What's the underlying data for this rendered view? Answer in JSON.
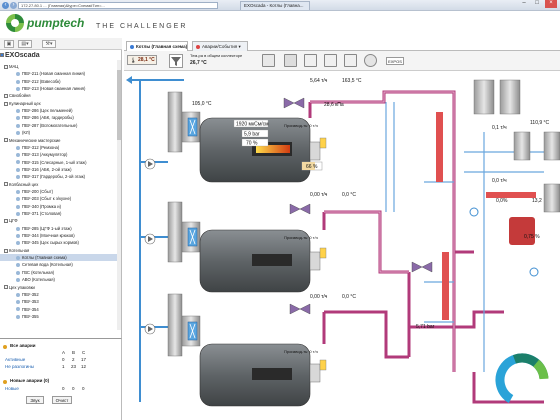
{
  "browser": {
    "url": "172.27.80.1 ... (Главная)&type=Схема#Тип=...",
    "tabs": [
      {
        "label": "EXOscada - Котлы (Главна..."
      }
    ],
    "win_min": "–",
    "win_max": "□",
    "win_close": "×"
  },
  "header": {
    "logo": "pumptech",
    "tagline": "THE CHALLENGER"
  },
  "sidebar": {
    "root": "EXOscada",
    "items": [
      {
        "label": "МАЦ",
        "level": 1
      },
      {
        "label": "ПВУ-211 (Новая сманная линия)",
        "level": 2
      },
      {
        "label": "ПВУ-212 (Взвесобк)",
        "level": 2
      },
      {
        "label": "ПВУ-213 (Новая сманная линия)",
        "level": 2
      },
      {
        "label": "Свиобойня",
        "level": 1
      },
      {
        "label": "Кулинарный цех",
        "level": 1
      },
      {
        "label": "ПВУ-286 (Цех пельменей)",
        "level": 2
      },
      {
        "label": "ПВУ-286 (АБК, гардеробы)",
        "level": 2
      },
      {
        "label": "ПВУ-287 (Вспомогательные)",
        "level": 2
      },
      {
        "label": "(КЛ)",
        "level": 2
      },
      {
        "label": "Механические мастерские",
        "level": 1
      },
      {
        "label": "ПВУ-312 (Ремзона)",
        "level": 2
      },
      {
        "label": "ПВУ-313 (Аккумулятор)",
        "level": 2
      },
      {
        "label": "ПВУ-315 (Слесарные, 1-ый этаж)",
        "level": 2
      },
      {
        "label": "ПВУ-316 (АБК, 2-ой этаж)",
        "level": 2
      },
      {
        "label": "ПВУ-317 (Гардеробы, 2-ой этаж)",
        "level": 2
      },
      {
        "label": "Колбасный цех",
        "level": 1
      },
      {
        "label": "ПВУ-200 (Сбыт)",
        "level": 2
      },
      {
        "label": "ПВУ-203 (Сбыт к э/кухне)",
        "level": 2
      },
      {
        "label": "ПВУ-340 (Промка и)",
        "level": 2
      },
      {
        "label": "ПВУ-371 (Столовая)",
        "level": 2
      },
      {
        "label": "ЦГФ",
        "level": 1
      },
      {
        "label": "ПВУ-285 (ЦГФ 1-ый этаж)",
        "level": 2
      },
      {
        "label": "ПВУ-344 (Моечная крюков)",
        "level": 2
      },
      {
        "label": "ПВУ-345 (Цех сырых кормов)",
        "level": 2
      },
      {
        "label": "Котельная",
        "level": 1
      },
      {
        "label": "Котлы (Главная схема)",
        "level": 2,
        "selected": true
      },
      {
        "label": "Сетевая вода (Котельная)",
        "level": 2
      },
      {
        "label": "ГВС (Котельная)",
        "level": 2
      },
      {
        "label": "АВО (Котельная)",
        "level": 2
      },
      {
        "label": "Цех упаковки",
        "level": 1
      },
      {
        "label": "ПВУ-352",
        "level": 2
      },
      {
        "label": "ПВУ-353",
        "level": 2
      },
      {
        "label": "ПВУ-354",
        "level": 2
      },
      {
        "label": "ПВУ-355",
        "level": 2
      }
    ]
  },
  "alarms": {
    "title_all": "Все аварии",
    "cols": [
      "A",
      "B",
      "C"
    ],
    "rows": [
      {
        "label": "Активные",
        "values": [
          "0",
          "2",
          "17"
        ]
      },
      {
        "label": "Не разлогины",
        "values": [
          "1",
          "23",
          "12"
        ]
      }
    ],
    "title_new": "Новые аварии (0)",
    "new_row": {
      "label": "Новые",
      "values": [
        "0",
        "0",
        "0"
      ]
    },
    "btn_sound": "Звук",
    "btn_clear": "Очист"
  },
  "main": {
    "tabs": [
      {
        "label": "Котлы (Главная схема)"
      },
      {
        "label": "Аварии/События ▾"
      }
    ],
    "toolbar": {
      "outdoor_temp": "28,1 °C",
      "return_temp_label": "Тем-ра в общем коллекторе",
      "return_temp": "26,7 °C",
      "exit_label": "EXPOS"
    }
  },
  "diagram": {
    "temp_left_top": "105,0 °C",
    "boiler1_power": "1920 мкСм/см",
    "boiler1_pressure": "5,9 bar",
    "boiler1_level": "70 %",
    "boiler1_mode": "Производ-ть: 0 т/ч",
    "boiler1_load": "66 %",
    "boiler2_mode": "Производ-ть: 0 т/ч",
    "boiler3_mode": "Производ-ть: 0 т/ч",
    "flow_top1": "5,64 т/ч",
    "temp_top1": "163,5 °C",
    "pressure_top1": "28,6 кПа",
    "flow_mid1": "0,00 т/ч",
    "temp_mid1": "0,0 °C",
    "flow_bot1": "0,00 т/ч",
    "temp_bot1": "0,0 °C",
    "header_pressure": "5,71 bar",
    "right_temp1": "110,9 °C",
    "right_flow1": "0,1 т/ч",
    "right_flow2": "0,0 т/ч",
    "right_pct": "0,0%",
    "right_val3": "13,2",
    "right_val4": "0,75 %"
  },
  "colors": {
    "steam": "#b13a7a",
    "water_blue": "#3f8ed1",
    "red_pipe": "#e05050",
    "boiler": "#6a6f72"
  }
}
